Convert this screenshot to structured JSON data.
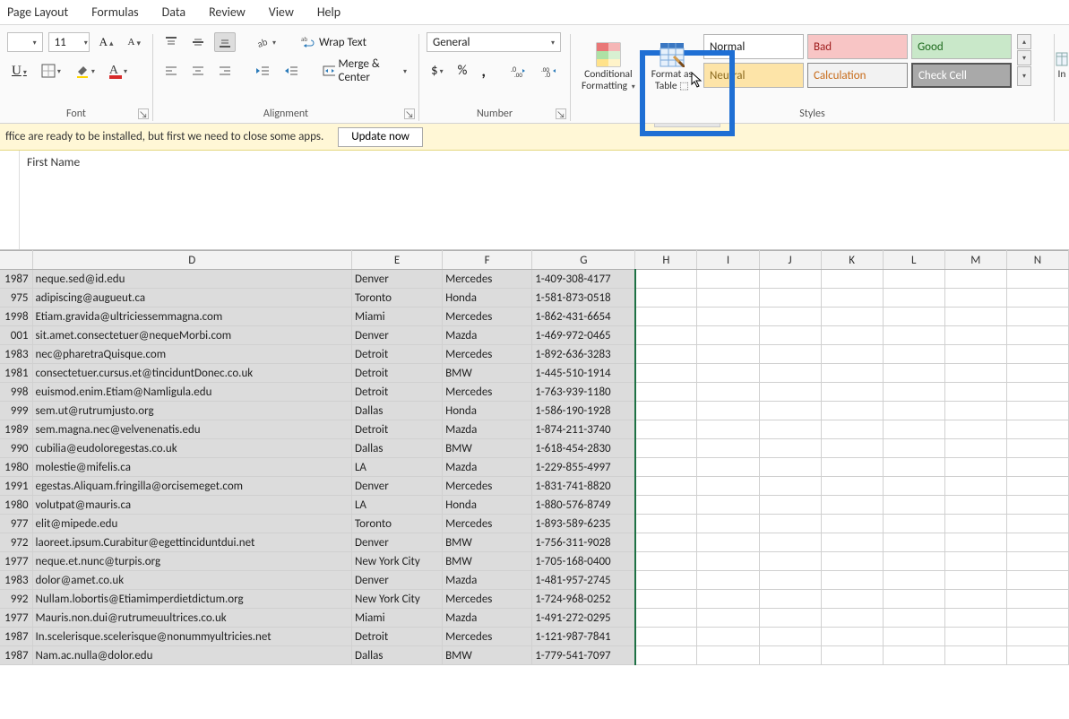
{
  "tabs": [
    "Page Layout",
    "Formulas",
    "Data",
    "Review",
    "View",
    "Help"
  ],
  "ribbon": {
    "font": {
      "size": "11",
      "label": "Font"
    },
    "alignment": {
      "wrap": "Wrap Text",
      "merge": "Merge & Center",
      "label": "Alignment"
    },
    "number": {
      "format": "General",
      "label": "Number"
    },
    "cond_fmt": {
      "l1": "Conditional",
      "l2": "Formatting"
    },
    "fmt_table": {
      "l1": "Format as",
      "l2": "Table"
    },
    "insert_partial": "In",
    "styles": {
      "normal": "Normal",
      "bad": "Bad",
      "good": "Good",
      "neutral": "Neutral",
      "calculation": "Calculation",
      "check": "Check Cell",
      "label": "Styles"
    }
  },
  "msgbar": {
    "text": "ffice are ready to be installed, but first we need to close some apps.",
    "btn": "Update now"
  },
  "formula": {
    "value": "First Name"
  },
  "columns": [
    "D",
    "E",
    "F",
    "G",
    "H",
    "I",
    "J",
    "K",
    "L",
    "M",
    "N"
  ],
  "rows": [
    {
      "n": "1987",
      "d": "neque.sed@id.edu",
      "e": "Denver",
      "f": "Mercedes",
      "g": "1-409-308-4177"
    },
    {
      "n": "975",
      "d": "adipiscing@augueut.ca",
      "e": "Toronto",
      "f": "Honda",
      "g": "1-581-873-0518"
    },
    {
      "n": "1998",
      "d": "Etiam.gravida@ultriciessemmagna.com",
      "e": "Miami",
      "f": "Mercedes",
      "g": "1-862-431-6654"
    },
    {
      "n": "001",
      "d": "sit.amet.consectetuer@nequeMorbi.com",
      "e": "Denver",
      "f": "Mazda",
      "g": "1-469-972-0465"
    },
    {
      "n": "1983",
      "d": "nec@pharetraQuisque.com",
      "e": "Detroit",
      "f": "Mercedes",
      "g": "1-892-636-3283"
    },
    {
      "n": "1981",
      "d": "consectetuer.cursus.et@tinciduntDonec.co.uk",
      "e": "Detroit",
      "f": "BMW",
      "g": "1-445-510-1914"
    },
    {
      "n": "998",
      "d": "euismod.enim.Etiam@Namligula.edu",
      "e": "Detroit",
      "f": "Mercedes",
      "g": "1-763-939-1180"
    },
    {
      "n": "999",
      "d": "sem.ut@rutrumjusto.org",
      "e": "Dallas",
      "f": "Honda",
      "g": "1-586-190-1928"
    },
    {
      "n": "1989",
      "d": "sem.magna.nec@velvenenatis.edu",
      "e": "Detroit",
      "f": "Mazda",
      "g": "1-874-211-3740"
    },
    {
      "n": "990",
      "d": "cubilia@eudoloregestas.co.uk",
      "e": "Dallas",
      "f": "BMW",
      "g": "1-618-454-2830"
    },
    {
      "n": "1980",
      "d": "molestie@mifelis.ca",
      "e": "LA",
      "f": "Mazda",
      "g": "1-229-855-4997"
    },
    {
      "n": "1991",
      "d": "egestas.Aliquam.fringilla@orcisemeget.com",
      "e": "Denver",
      "f": "Mercedes",
      "g": "1-831-741-8820"
    },
    {
      "n": "1980",
      "d": "volutpat@mauris.ca",
      "e": "LA",
      "f": "Honda",
      "g": "1-880-576-8749"
    },
    {
      "n": "977",
      "d": "elit@mipede.edu",
      "e": "Toronto",
      "f": "Mercedes",
      "g": "1-893-589-6235"
    },
    {
      "n": "972",
      "d": "laoreet.ipsum.Curabitur@egettinciduntdui.net",
      "e": "Denver",
      "f": "BMW",
      "g": "1-756-311-9028"
    },
    {
      "n": "1977",
      "d": "neque.et.nunc@turpis.org",
      "e": "New York City",
      "f": "BMW",
      "g": "1-705-168-0400"
    },
    {
      "n": "1983",
      "d": "dolor@amet.co.uk",
      "e": "Denver",
      "f": "Mazda",
      "g": "1-481-957-2745"
    },
    {
      "n": "992",
      "d": "Nullam.lobortis@Etiamimperdietdictum.org",
      "e": "New York City",
      "f": "Mercedes",
      "g": "1-724-968-0252"
    },
    {
      "n": "1977",
      "d": "Mauris.non.dui@rutrumeuultrices.co.uk",
      "e": "Miami",
      "f": "Mazda",
      "g": "1-491-272-0295"
    },
    {
      "n": "1987",
      "d": "In.scelerisque.scelerisque@nonummyultricies.net",
      "e": "Detroit",
      "f": "Mercedes",
      "g": "1-121-987-7841"
    },
    {
      "n": "1987",
      "d": "Nam.ac.nulla@dolor.edu",
      "e": "Dallas",
      "f": "BMW",
      "g": "1-779-541-7097"
    }
  ]
}
